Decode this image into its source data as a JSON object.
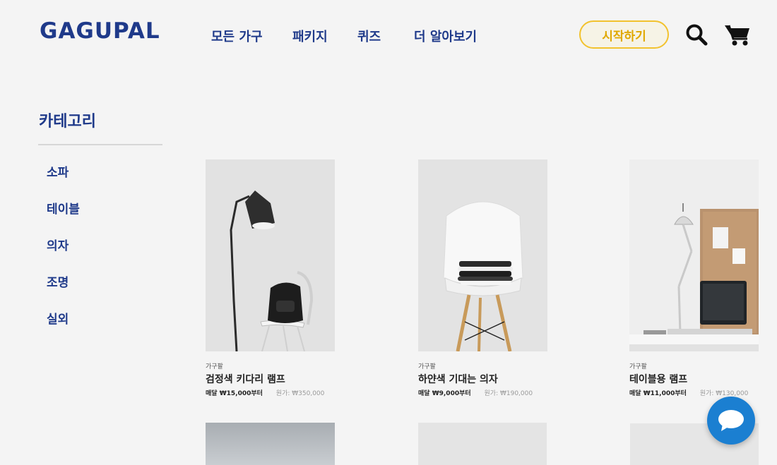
{
  "header": {
    "logo": "GAGUPAL",
    "nav": [
      {
        "label": "모든 가구"
      },
      {
        "label": "패키지"
      },
      {
        "label": "퀴즈"
      },
      {
        "label": "더 알아보기"
      }
    ],
    "start_button": "시작하기",
    "search_icon": "search-icon",
    "cart_icon": "cart-icon"
  },
  "sidebar": {
    "title": "카테고리",
    "items": [
      {
        "label": "소파"
      },
      {
        "label": "테이블"
      },
      {
        "label": "의자"
      },
      {
        "label": "조명"
      },
      {
        "label": "실외"
      }
    ]
  },
  "products": [
    {
      "brand": "가구팔",
      "name": "검정색 키다리 램프",
      "monthly": "매달 ₩15,000부터",
      "original": "원가: ₩350,000"
    },
    {
      "brand": "가구팔",
      "name": "하얀색 기대는 의자",
      "monthly": "매달 ₩9,000부터",
      "original": "원가: ₩190,000"
    },
    {
      "brand": "가구팔",
      "name": "테이블용 램프",
      "monthly": "매달 ₩11,000부터",
      "original": "원가: ₩130,000"
    }
  ],
  "colors": {
    "brand": "#1f3a8a",
    "accent": "#f2c22e",
    "chat": "#1b7fd1"
  },
  "chat_icon": "chat-bubble-icon"
}
